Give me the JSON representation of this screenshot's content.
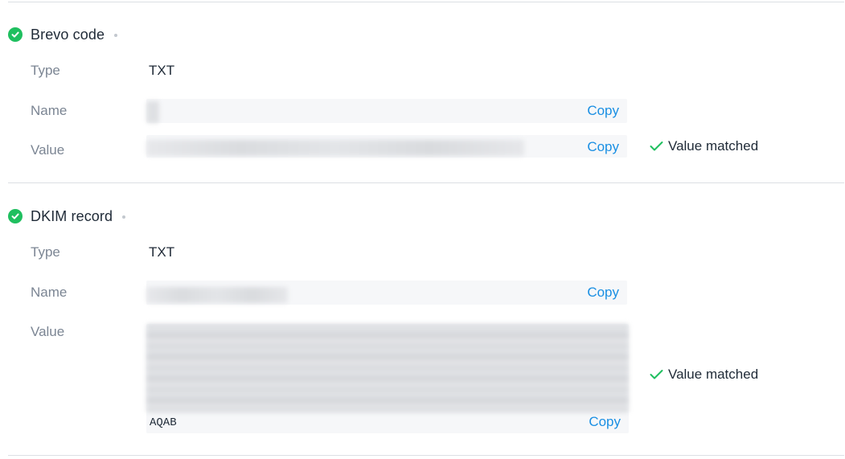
{
  "records": [
    {
      "title": "Brevo code",
      "type_label": "Type",
      "type_value": "TXT",
      "name_label": "Name",
      "value_label": "Value",
      "copy_label": "Copy",
      "status": "Value matched"
    },
    {
      "title": "DKIM record",
      "type_label": "Type",
      "type_value": "TXT",
      "name_label": "Name",
      "value_label": "Value",
      "value_tail": "AQAB",
      "copy_label": "Copy",
      "status": "Value matched"
    }
  ],
  "colors": {
    "success": "#1fbf5f",
    "link": "#1a8fe3",
    "label": "#7b8593",
    "field_bg": "#f6f7f9"
  },
  "icons": [
    "check-circle-icon",
    "checkmark-icon",
    "dot-icon"
  ]
}
